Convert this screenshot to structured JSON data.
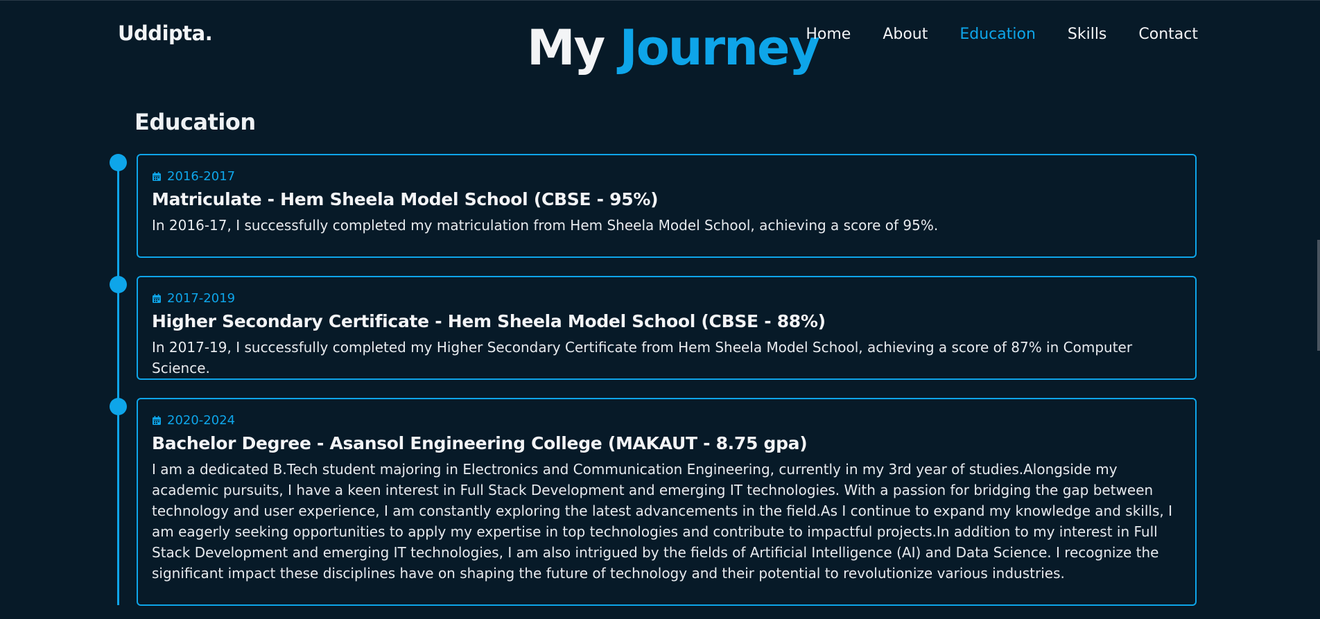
{
  "header": {
    "logo": "Uddipta.",
    "hero_word1": "My",
    "hero_word2": "Journey",
    "nav": [
      {
        "label": "Home",
        "active": false
      },
      {
        "label": "About",
        "active": false
      },
      {
        "label": "Education",
        "active": true
      },
      {
        "label": "Skills",
        "active": false
      },
      {
        "label": "Contact",
        "active": false
      }
    ]
  },
  "section": {
    "title": "Education"
  },
  "education": [
    {
      "date": "2016-2017",
      "title": "Matriculate - Hem Sheela Model School (CBSE - 95%)",
      "description": "In 2016-17, I successfully completed my matriculation from Hem Sheela Model School, achieving a score of 95%."
    },
    {
      "date": "2017-2019",
      "title": "Higher Secondary Certificate - Hem Sheela Model School (CBSE - 88%)",
      "description": "In 2017-19, I successfully completed my Higher Secondary Certificate from Hem Sheela Model School, achieving a score of 87% in Computer Science."
    },
    {
      "date": "2020-2024",
      "title": "Bachelor Degree - Asansol Engineering College (MAKAUT - 8.75 gpa)",
      "description": "I am a dedicated B.Tech student majoring in Electronics and Communication Engineering, currently in my 3rd year of studies.Alongside my academic pursuits, I have a keen interest in Full Stack Development and emerging IT technologies. With a passion for bridging the gap between technology and user experience, I am constantly exploring the latest advancements in the field.As I continue to expand my knowledge and skills, I am eagerly seeking opportunities to apply my expertise in top technologies and contribute to impactful projects.In addition to my interest in Full Stack Development and emerging IT technologies, I am also intrigued by the fields of Artificial Intelligence (AI) and Data Science. I recognize the significant impact these disciplines have on shaping the future of technology and their potential to revolutionize various industries."
    }
  ],
  "icons": {
    "date": "calendar-icon"
  },
  "colors": {
    "background": "#071a28",
    "accent": "#0ea5e9",
    "text": "#f3f4f6"
  }
}
